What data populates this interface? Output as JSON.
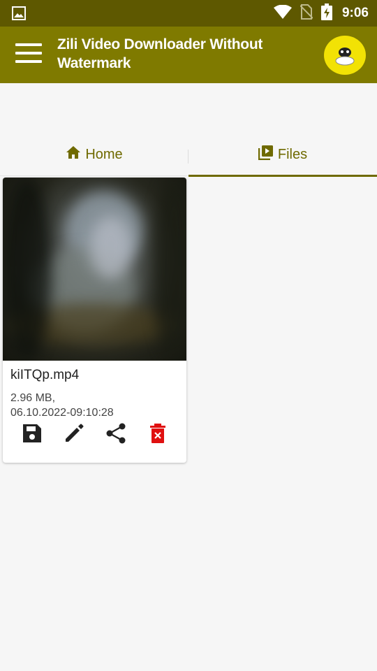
{
  "status_bar": {
    "time": "9:06",
    "icons": [
      "image-icon",
      "wifi-icon",
      "no-sim-icon",
      "battery-charging-icon"
    ]
  },
  "app_bar": {
    "title": "Zili Video Downloader Without Watermark",
    "menu_icon": "hamburger-menu-icon",
    "avatar": "avatar-icon"
  },
  "tabs": [
    {
      "label": "Home",
      "icon": "home-icon",
      "active": false
    },
    {
      "label": "Files",
      "icon": "video-library-icon",
      "active": true
    }
  ],
  "files": [
    {
      "name": "kiITQp.mp4",
      "size": "2.96 MB,",
      "date": "06.10.2022-09:10:28",
      "actions": [
        "save-icon",
        "edit-icon",
        "share-icon",
        "delete-icon"
      ]
    }
  ],
  "colors": {
    "status_bar": "#5e5800",
    "app_bar": "#7f7a00",
    "accent": "#6f6a00",
    "delete": "#e01010",
    "avatar_bg": "#f2e205"
  }
}
